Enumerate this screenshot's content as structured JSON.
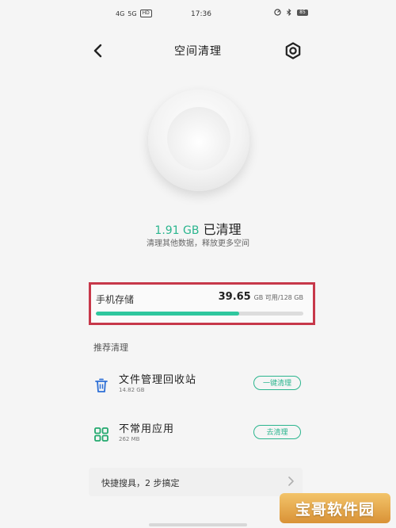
{
  "status_bar": {
    "signal1": "4G",
    "signal2": "5G",
    "volte": "HD",
    "time": "17:36",
    "battery": "85"
  },
  "header": {
    "title": "空间清理",
    "back_icon": "chevron-left-icon",
    "settings_icon": "gear-icon"
  },
  "cleaned": {
    "amount": "1.91 GB",
    "label": "已清理",
    "subtitle": "清理其他数据，释放更多空间"
  },
  "storage": {
    "label": "手机存储",
    "available": "39.65",
    "available_unit": "GB 可用",
    "total": "/128 GB",
    "used_fraction": 0.69
  },
  "recommend": {
    "title": "推荐清理",
    "items": [
      {
        "name": "文件管理回收站",
        "size": "14.82 GB",
        "button": "一键清理",
        "icon": "trash-icon"
      },
      {
        "name": "不常用应用",
        "size": "262 MB",
        "button": "去清理",
        "icon": "apps-grid-icon"
      }
    ]
  },
  "quick": {
    "label": "快捷搜具，2 步搞定",
    "chevron": "chevron-right-icon"
  },
  "watermark": {
    "text": "宝哥软件园"
  },
  "colors": {
    "accent": "#2bb58e",
    "highlight_border": "#c7384a"
  }
}
